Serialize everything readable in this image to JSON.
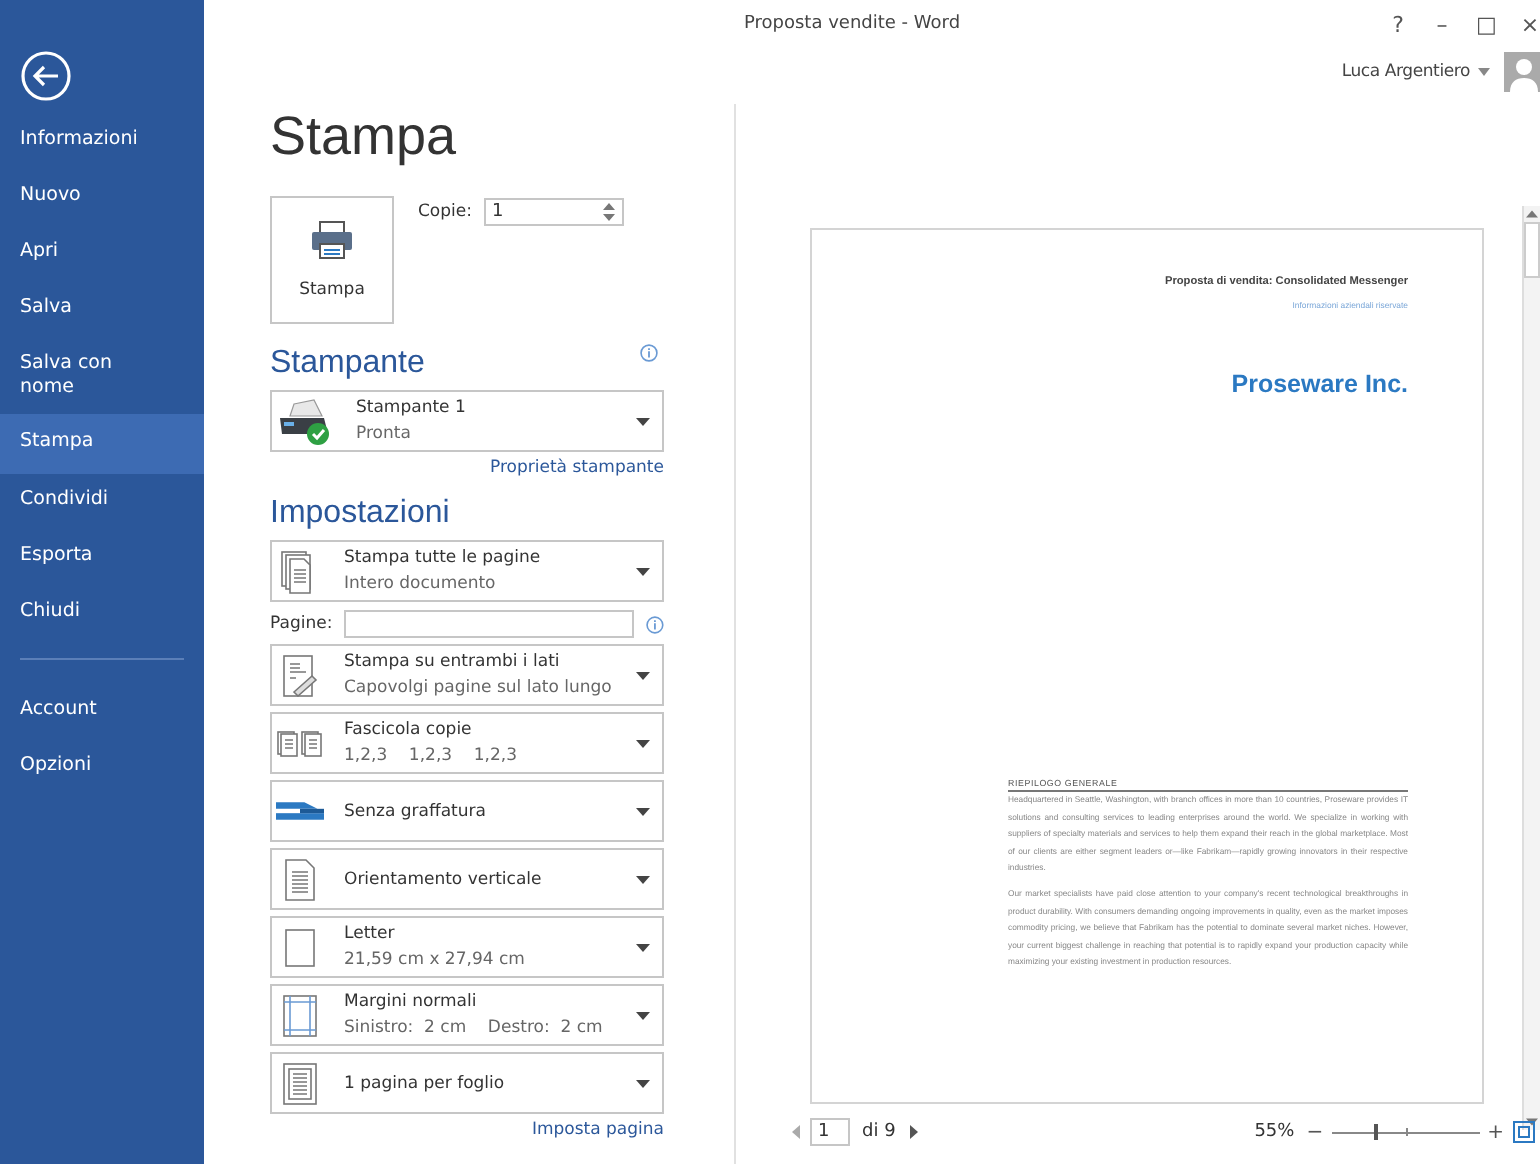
{
  "window": {
    "title": "Proposta vendite - Word",
    "controls": [
      "?",
      "–",
      "□",
      "×"
    ],
    "user": "Luca Argentiero"
  },
  "sidebar": {
    "items": [
      {
        "label": "Informazioni",
        "selected": false
      },
      {
        "label": "Nuovo",
        "selected": false
      },
      {
        "label": "Apri",
        "selected": false
      },
      {
        "label": "Salva",
        "selected": false
      },
      {
        "label": "Salva con nome",
        "selected": false
      },
      {
        "label": "Stampa",
        "selected": true
      },
      {
        "label": "Condividi",
        "selected": false
      },
      {
        "label": "Esporta",
        "selected": false
      },
      {
        "label": "Chiudi",
        "selected": false
      }
    ],
    "footer_items": [
      {
        "label": "Account",
        "selected": false
      },
      {
        "label": "Opzioni",
        "selected": false
      }
    ]
  },
  "page_title": "Stampa",
  "print_button": "Stampa",
  "copies": {
    "label": "Copie:",
    "value": "1"
  },
  "printer": {
    "heading": "Stampante",
    "name": "Stampante 1",
    "status": "Pronta",
    "link": "Proprietà stampante"
  },
  "settings": {
    "heading": "Impostazioni",
    "link": "Imposta pagina",
    "items": [
      {
        "kind": "pages",
        "title": "Stampa tutte le pagine",
        "subtitle": "Intero documento"
      },
      {
        "kind": "field",
        "title": "Pagine:"
      },
      {
        "kind": "duplex",
        "title": "Stampa su entrambi i lati",
        "subtitle": "Capovolgi pagine sul lato lungo"
      },
      {
        "kind": "collate",
        "title": "Fascicola copie",
        "subtitle": "1,2,3    1,2,3    1,2,3"
      },
      {
        "kind": "staple",
        "title": "Senza graffatura"
      },
      {
        "kind": "orientation",
        "title": "Orientamento verticale"
      },
      {
        "kind": "paper",
        "title": "Letter",
        "subtitle": "21,59 cm x 27,94 cm"
      },
      {
        "kind": "margins",
        "title": "Margini normali",
        "subtitle": "Sinistro:  2 cm    Destro:  2 cm"
      },
      {
        "kind": "per-sheet",
        "title": "1 pagina per foglio"
      }
    ]
  },
  "preview": {
    "header": "Proposta di vendita: Consolidated Messenger",
    "subheader": "Informazioni aziendali riservate",
    "company": "Proseware Inc.",
    "section_heading": "RIEPILOGO GENERALE",
    "paragraphs": [
      "Headquartered in Seattle, Washington, with branch offices in more than 10 countries, Proseware provides IT solutions and consulting services to leading enterprises around the world. We specialize in working with suppliers of specialty materials and services to help them expand their reach in the global marketplace. Most of our clients are either segment leaders or—like Fabrikam—rapidly growing innovators in their respective industries.",
      "Our market specialists have paid close attention to your company's recent technological breakthroughs in product durability. With consumers demanding ongoing improvements in quality, even as the market imposes commodity pricing, we believe that Fabrikam has the potential to dominate several market niches. However, your current biggest challenge in reaching that potential is to rapidly expand your production capacity while maximizing your existing investment in production resources."
    ]
  },
  "navigation": {
    "page": "1",
    "of": "di 9",
    "zoom": "55%",
    "zoom_minus": "−",
    "zoom_plus": "+",
    "level": 0.3
  }
}
